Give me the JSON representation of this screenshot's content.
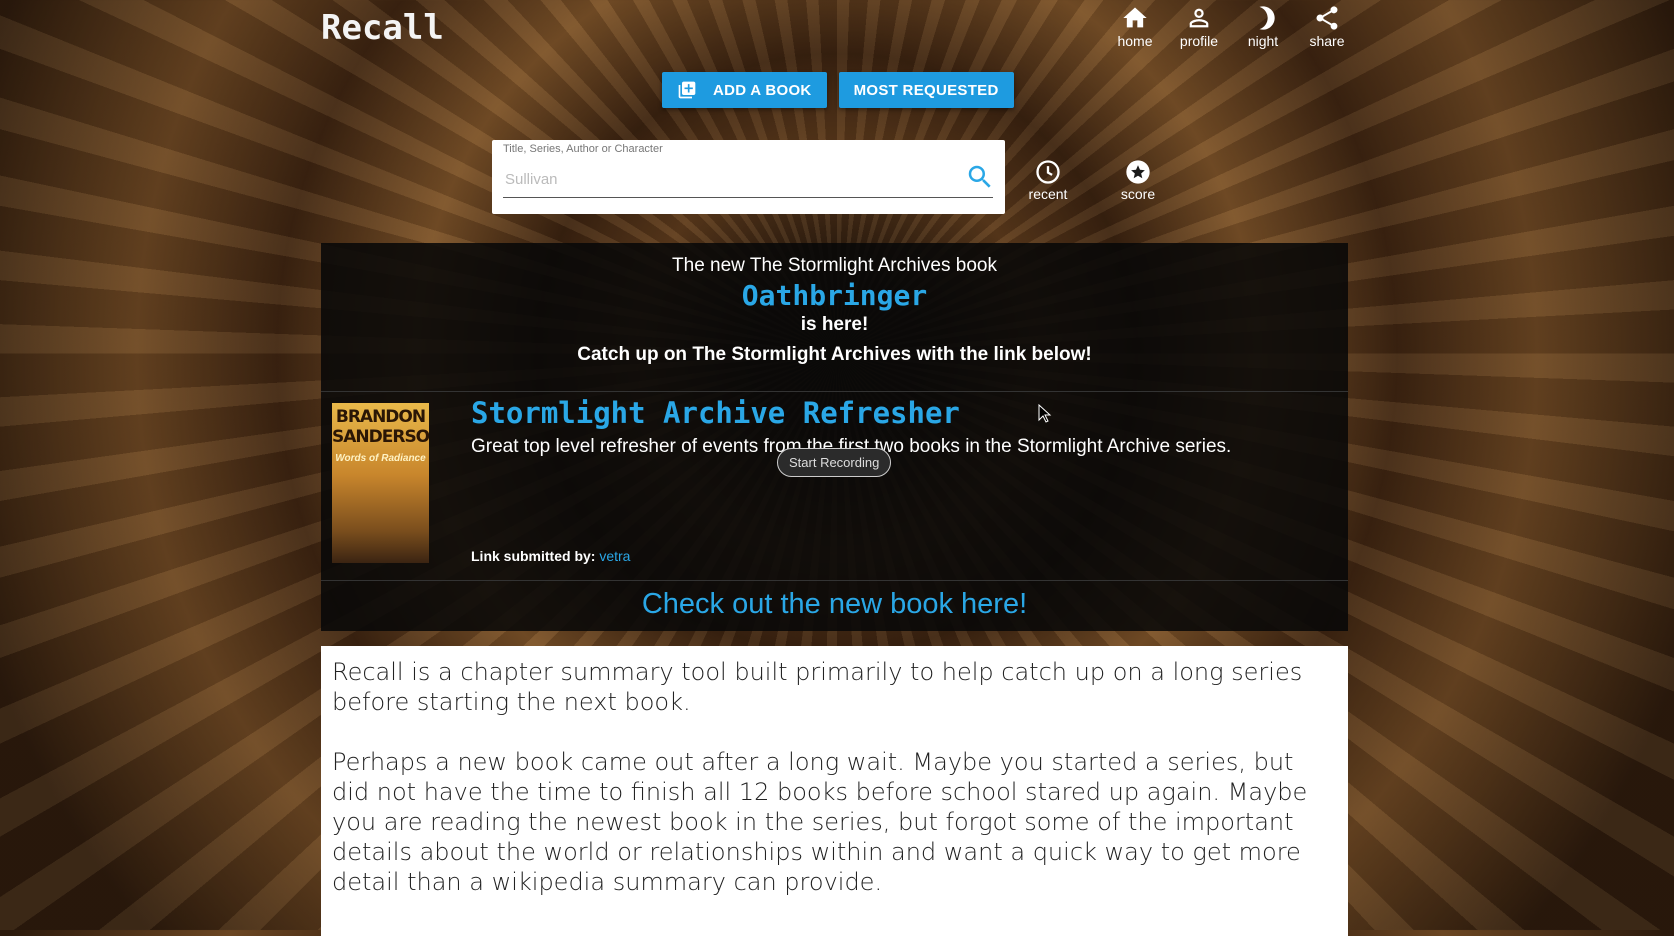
{
  "app": {
    "logo": "Recall"
  },
  "nav": [
    {
      "label": "home",
      "icon": "home-icon"
    },
    {
      "label": "profile",
      "icon": "person-icon"
    },
    {
      "label": "night",
      "icon": "moon-icon"
    },
    {
      "label": "share",
      "icon": "share-icon"
    }
  ],
  "buttons": {
    "add_book": "ADD A BOOK",
    "most_requested": "MOST REQUESTED"
  },
  "search": {
    "label": "Title, Series, Author or Character",
    "placeholder": "Sullivan"
  },
  "tools": {
    "recent": "recent",
    "score": "score"
  },
  "announcement": {
    "line1": "The new The Stormlight Archives book",
    "title": "Oathbringer",
    "line3": "is here!",
    "line4": "Catch up on The Stormlight Archives with the link below!",
    "card": {
      "cover_author": "BRANDON SANDERSON",
      "cover_title": "Words of Radiance",
      "title": "Stormlight Archive Refresher",
      "description": "Great top level refresher of events from the first two books in the Stormlight Archive series.",
      "submitted_label": "Link submitted by:",
      "submitted_user": "vetra"
    },
    "record_button": "Start Recording",
    "link": "Check out the new book here!"
  },
  "about": {
    "p1": "Recall is a chapter summary tool built primarily to help catch up on a long series before starting the next book.",
    "p2": "Perhaps a new book came out after a long wait. Maybe you started a series, but did not have the time to finish all 12 books before school stared up again. Maybe you are reading the newest book in the series, but forgot some of the important details about the world or relationships within and want a quick way to get more detail than a wikipedia summary can provide."
  },
  "colors": {
    "accent": "#2aa7e6",
    "button": "#1e9be0"
  }
}
